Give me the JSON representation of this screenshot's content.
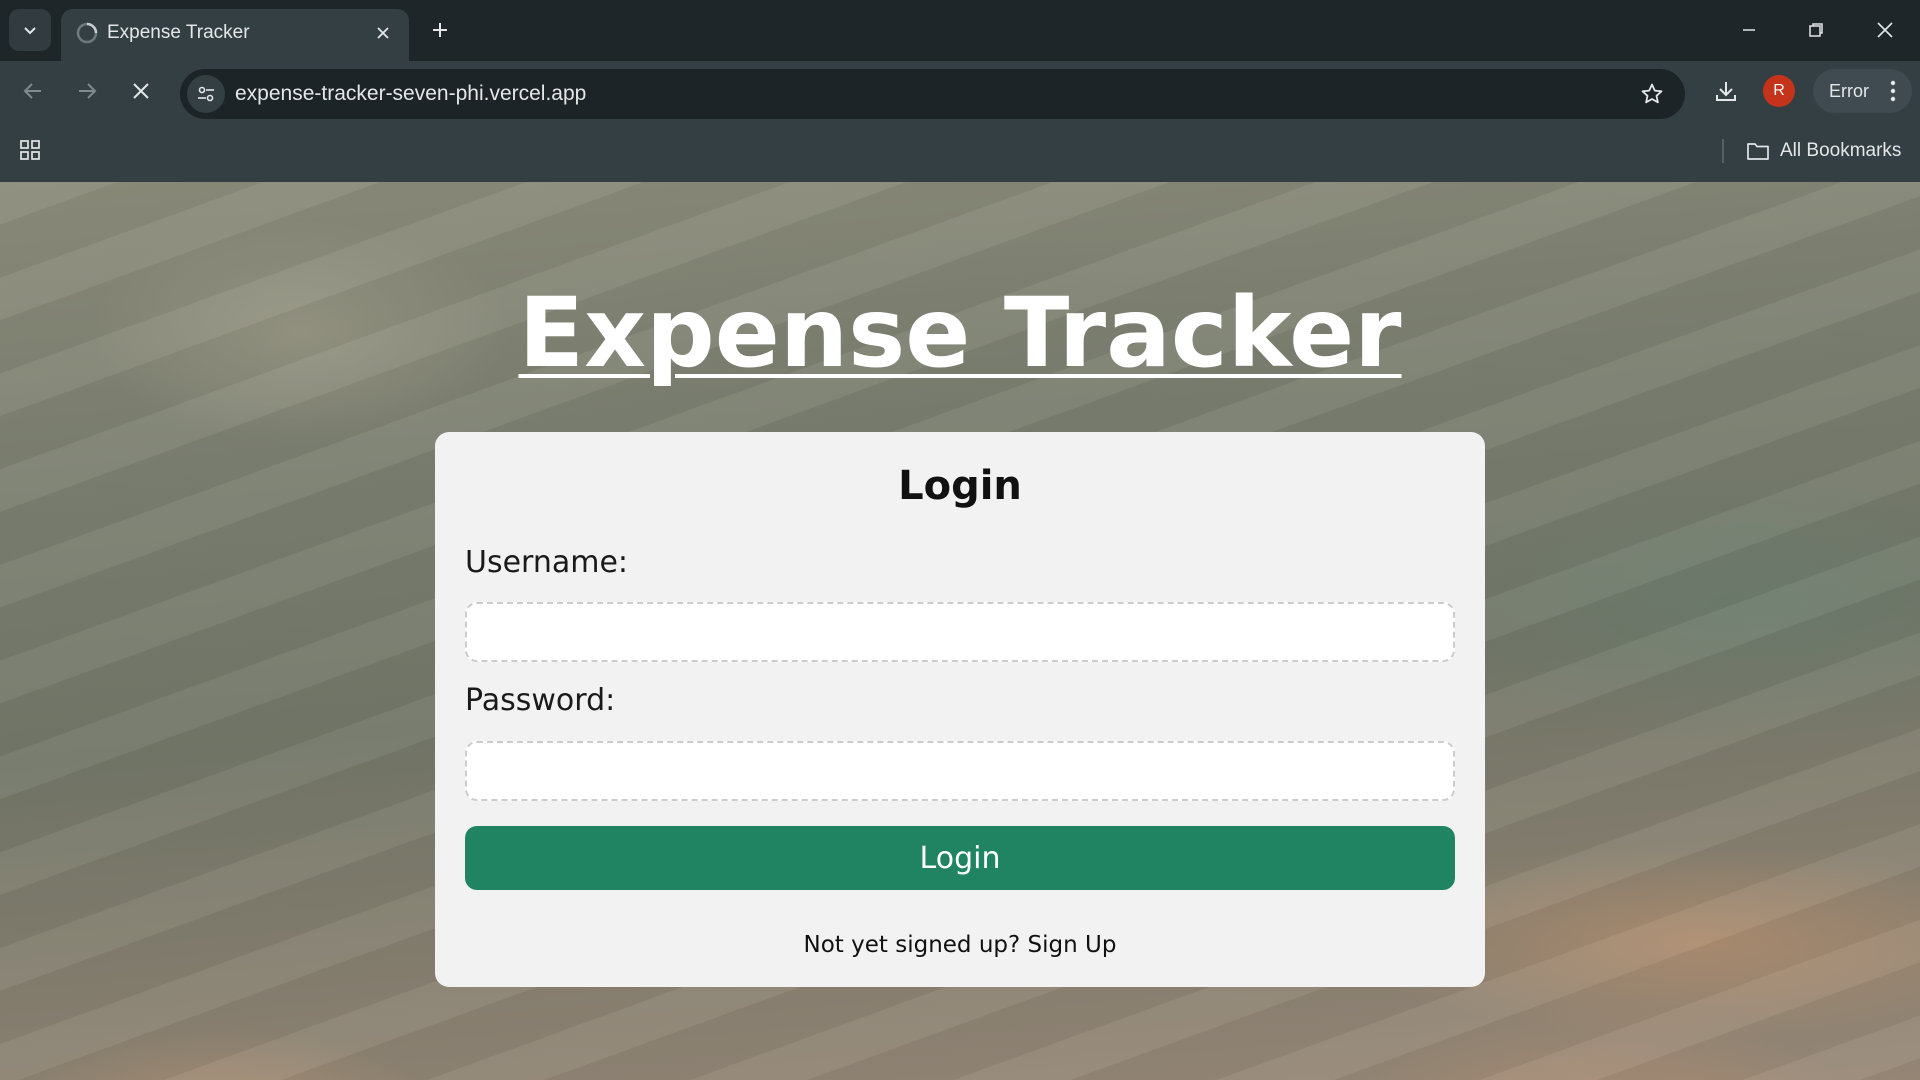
{
  "browser": {
    "tab_title": "Expense Tracker",
    "url": "expense-tracker-seven-phi.vercel.app",
    "profile_initial": "R",
    "status_chip": "Error",
    "bookmarks_label": "All Bookmarks",
    "colors": {
      "profile_avatar": "#c5331b"
    }
  },
  "page": {
    "site_title": "Expense Tracker",
    "login_form": {
      "heading": "Login",
      "username_label": "Username:",
      "username_value": "",
      "password_label": "Password:",
      "password_value": "",
      "submit_label": "Login",
      "signup_prompt": "Not yet signed up?",
      "signup_link": "Sign Up"
    },
    "colors": {
      "primary_button": "#208463",
      "card_background": "#f2f2f2"
    }
  }
}
